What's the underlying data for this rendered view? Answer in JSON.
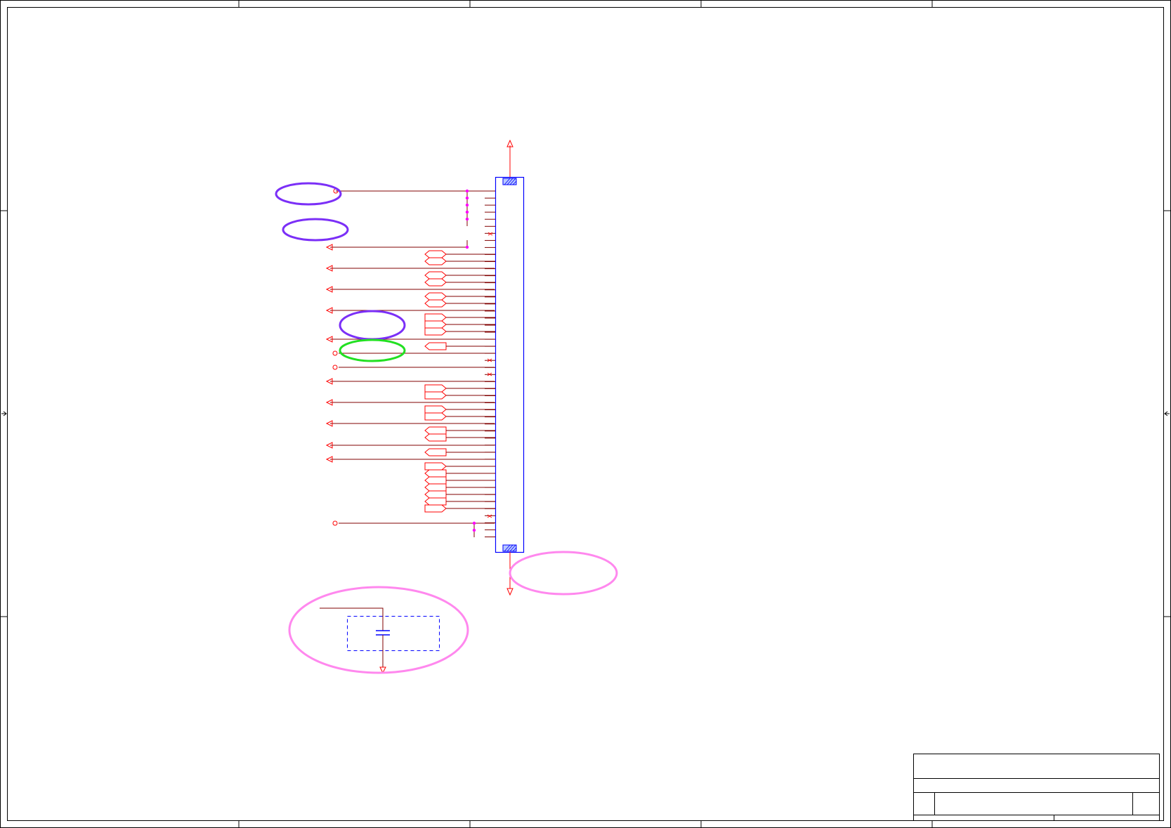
{
  "colors": {
    "frame": "#000000",
    "wire": "#800000",
    "port": "#ff0000",
    "junction": "#ff00ff",
    "connector": "#0000ff",
    "highlight_purple": "#7b2ff7",
    "highlight_green": "#22e022",
    "highlight_pink": "#ff88ee"
  },
  "title_block": {
    "title": "",
    "sheet": ""
  }
}
